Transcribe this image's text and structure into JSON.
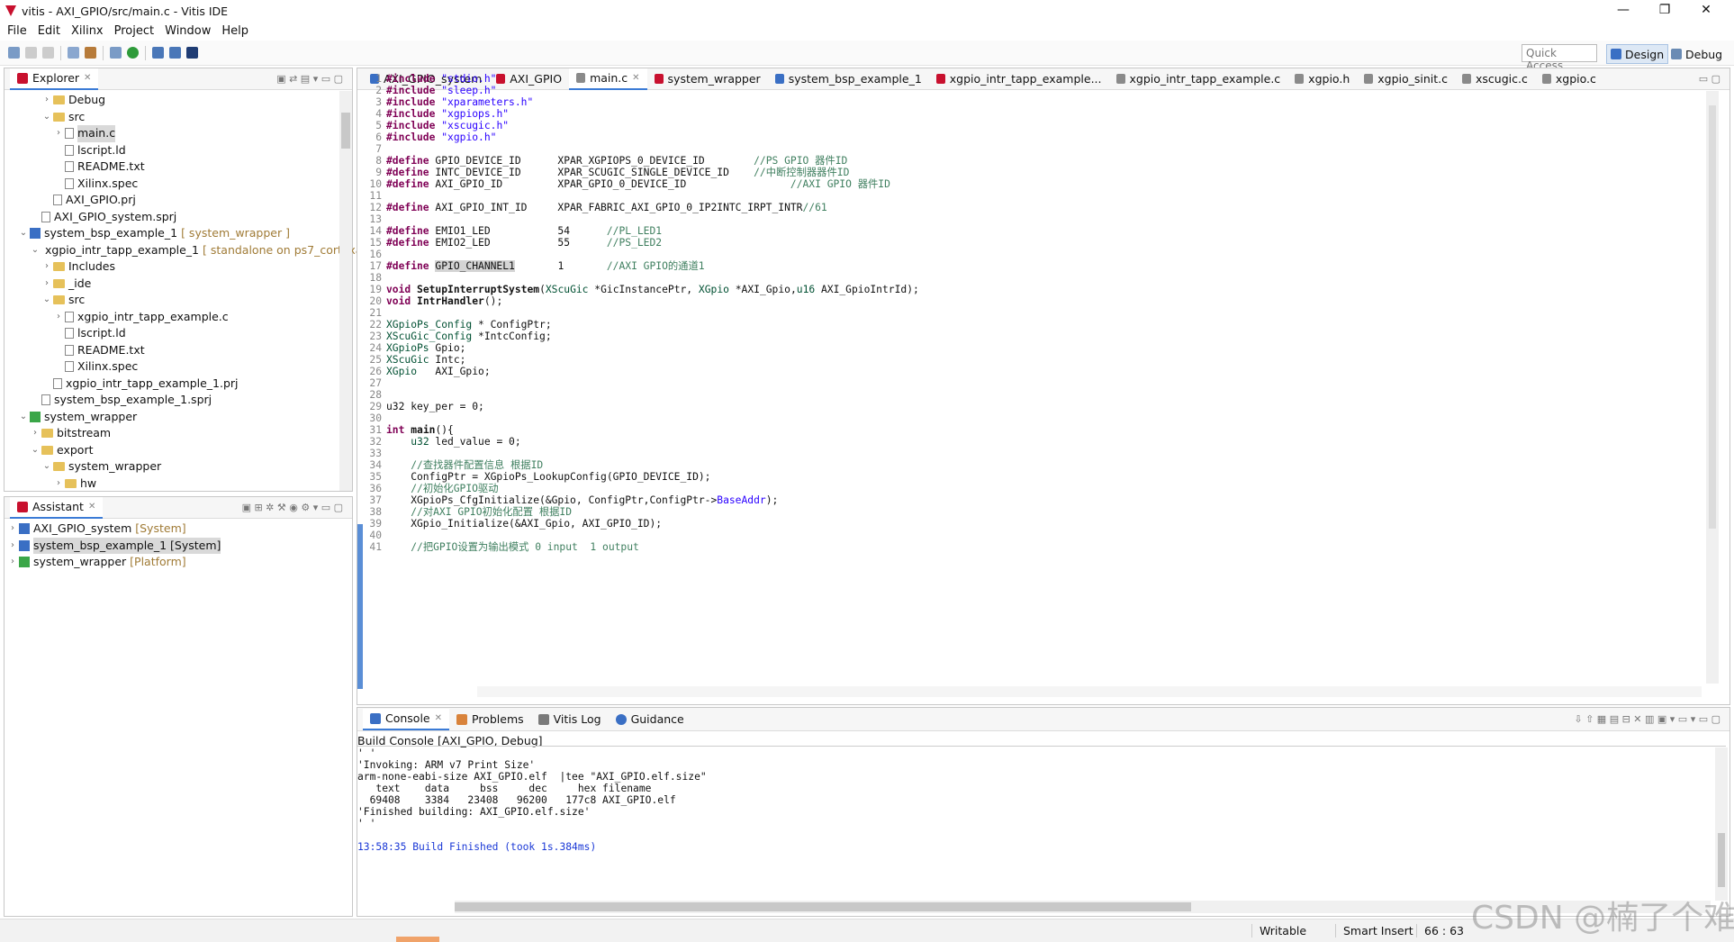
{
  "window": {
    "title": "vitis - AXI_GPIO/src/main.c - Vitis IDE"
  },
  "menu": [
    "File",
    "Edit",
    "Xilinx",
    "Project",
    "Window",
    "Help"
  ],
  "quick_access": "Quick Access",
  "perspectives": {
    "design": "Design",
    "debug": "Debug"
  },
  "explorer": {
    "tab": "Explorer",
    "rows": [
      {
        "indent": 2,
        "tw": "›",
        "icon": "folder",
        "label": "Debug",
        "dec": ""
      },
      {
        "indent": 2,
        "tw": "⌄",
        "icon": "folder",
        "label": "src",
        "dec": ""
      },
      {
        "indent": 3,
        "tw": "›",
        "icon": "file",
        "label": "main.c",
        "dec": "",
        "selected": true
      },
      {
        "indent": 3,
        "tw": "",
        "icon": "file",
        "label": "lscript.ld",
        "dec": ""
      },
      {
        "indent": 3,
        "tw": "",
        "icon": "file",
        "label": "README.txt",
        "dec": ""
      },
      {
        "indent": 3,
        "tw": "",
        "icon": "file",
        "label": "Xilinx.spec",
        "dec": ""
      },
      {
        "indent": 2,
        "tw": "",
        "icon": "file",
        "label": "AXI_GPIO.prj",
        "dec": ""
      },
      {
        "indent": 1,
        "tw": "",
        "icon": "file",
        "label": "AXI_GPIO_system.sprj",
        "dec": ""
      },
      {
        "indent": 0,
        "tw": "⌄",
        "icon": "proj",
        "label": "system_bsp_example_1",
        "dec": "[ system_wrapper ]"
      },
      {
        "indent": 1,
        "tw": "⌄",
        "icon": "proj",
        "label": "xgpio_intr_tapp_example_1",
        "dec": "[ standalone on ps7_cortexa9_0 ]"
      },
      {
        "indent": 2,
        "tw": "›",
        "icon": "folder",
        "label": "Includes",
        "dec": ""
      },
      {
        "indent": 2,
        "tw": "›",
        "icon": "folder",
        "label": "_ide",
        "dec": ""
      },
      {
        "indent": 2,
        "tw": "⌄",
        "icon": "folder",
        "label": "src",
        "dec": ""
      },
      {
        "indent": 3,
        "tw": "›",
        "icon": "file",
        "label": "xgpio_intr_tapp_example.c",
        "dec": ""
      },
      {
        "indent": 3,
        "tw": "",
        "icon": "file",
        "label": "lscript.ld",
        "dec": ""
      },
      {
        "indent": 3,
        "tw": "",
        "icon": "file",
        "label": "README.txt",
        "dec": ""
      },
      {
        "indent": 3,
        "tw": "",
        "icon": "file",
        "label": "Xilinx.spec",
        "dec": ""
      },
      {
        "indent": 2,
        "tw": "",
        "icon": "file",
        "label": "xgpio_intr_tapp_example_1.prj",
        "dec": ""
      },
      {
        "indent": 1,
        "tw": "",
        "icon": "file",
        "label": "system_bsp_example_1.sprj",
        "dec": ""
      },
      {
        "indent": 0,
        "tw": "⌄",
        "icon": "plat",
        "label": "system_wrapper",
        "dec": ""
      },
      {
        "indent": 1,
        "tw": "›",
        "icon": "folder",
        "label": "bitstream",
        "dec": ""
      },
      {
        "indent": 1,
        "tw": "⌄",
        "icon": "folder",
        "label": "export",
        "dec": ""
      },
      {
        "indent": 2,
        "tw": "⌄",
        "icon": "folder",
        "label": "system_wrapper",
        "dec": ""
      },
      {
        "indent": 3,
        "tw": "›",
        "icon": "folder",
        "label": "hw",
        "dec": ""
      }
    ]
  },
  "assistant": {
    "tab": "Assistant",
    "rows": [
      {
        "label": "AXI_GPIO_system",
        "dec": "[System]",
        "icon": "proj",
        "selected": false
      },
      {
        "label": "system_bsp_example_1 [System]",
        "dec": "",
        "icon": "proj",
        "selected": true
      },
      {
        "label": "system_wrapper",
        "dec": "[Platform]",
        "icon": "plat",
        "selected": false
      }
    ]
  },
  "editor_tabs": [
    {
      "label": "AXI_GPIO_system",
      "active": false
    },
    {
      "label": "AXI_GPIO",
      "active": false
    },
    {
      "label": "main.c",
      "active": true
    },
    {
      "label": "system_wrapper",
      "active": false
    },
    {
      "label": "system_bsp_example_1",
      "active": false
    },
    {
      "label": "xgpio_intr_tapp_example...",
      "active": false
    },
    {
      "label": "xgpio_intr_tapp_example.c",
      "active": false
    },
    {
      "label": "xgpio.h",
      "active": false
    },
    {
      "label": "xgpio_sinit.c",
      "active": false
    },
    {
      "label": "xscugic.c",
      "active": false
    },
    {
      "label": "xgpio.c",
      "active": false
    }
  ],
  "code_lines": [
    [
      [
        "kw",
        "#include"
      ],
      [
        "t",
        " "
      ],
      [
        "str",
        "\"stdio.h\""
      ]
    ],
    [
      [
        "kw",
        "#include"
      ],
      [
        "t",
        " "
      ],
      [
        "str",
        "\"sleep.h\""
      ]
    ],
    [
      [
        "kw",
        "#include"
      ],
      [
        "t",
        " "
      ],
      [
        "str",
        "\"xparameters.h\""
      ]
    ],
    [
      [
        "kw",
        "#include"
      ],
      [
        "t",
        " "
      ],
      [
        "str",
        "\"xgpiops.h\""
      ]
    ],
    [
      [
        "kw",
        "#include"
      ],
      [
        "t",
        " "
      ],
      [
        "str",
        "\"xscugic.h\""
      ]
    ],
    [
      [
        "kw",
        "#include"
      ],
      [
        "t",
        " "
      ],
      [
        "str",
        "\"xgpio.h\""
      ]
    ],
    [],
    [
      [
        "kw",
        "#define"
      ],
      [
        "t",
        " GPIO_DEVICE_ID      XPAR_XGPIOPS_0_DEVICE_ID        "
      ],
      [
        "cmt",
        "//PS GPIO 器件ID"
      ]
    ],
    [
      [
        "kw",
        "#define"
      ],
      [
        "t",
        " INTC_DEVICE_ID      XPAR_SCUGIC_SINGLE_DEVICE_ID    "
      ],
      [
        "cmt",
        "//中断控制器器件ID"
      ]
    ],
    [
      [
        "kw",
        "#define"
      ],
      [
        "t",
        " AXI_GPIO_ID         XPAR_GPIO_0_DEVICE_ID                 "
      ],
      [
        "cmt",
        "//AXI GPIO 器件ID"
      ]
    ],
    [],
    [
      [
        "kw",
        "#define"
      ],
      [
        "t",
        " AXI_GPIO_INT_ID     XPAR_FABRIC_AXI_GPIO_0_IP2INTC_IRPT_INTR"
      ],
      [
        "cmt",
        "//61"
      ]
    ],
    [],
    [
      [
        "kw",
        "#define"
      ],
      [
        "t",
        " EMIO1_LED           54      "
      ],
      [
        "cmt",
        "//PL_LED1"
      ]
    ],
    [
      [
        "kw",
        "#define"
      ],
      [
        "t",
        " EMIO2_LED           55      "
      ],
      [
        "cmt",
        "//PS_LED2"
      ]
    ],
    [],
    [
      [
        "kw",
        "#define"
      ],
      [
        "t",
        " GPIO_CHANNEL1       1       "
      ],
      [
        "cmt",
        "//AXI GPIO的通道1"
      ]
    ],
    [],
    [
      [
        "kw",
        "void"
      ],
      [
        "t",
        " "
      ],
      [
        "fn",
        "SetupInterruptSystem"
      ],
      [
        "t",
        "("
      ],
      [
        "ty",
        "XScuGic"
      ],
      [
        "t",
        " *GicInstancePtr, "
      ],
      [
        "ty",
        "XGpio"
      ],
      [
        "t",
        " *AXI_Gpio,"
      ],
      [
        "ty",
        "u16"
      ],
      [
        "t",
        " AXI_GpioIntrId);"
      ]
    ],
    [
      [
        "kw",
        "void"
      ],
      [
        "t",
        " "
      ],
      [
        "fn",
        "IntrHandler"
      ],
      [
        "t",
        "();"
      ]
    ],
    [],
    [
      [
        "ty",
        "XGpioPs_Config"
      ],
      [
        "t",
        " * ConfigPtr;"
      ]
    ],
    [
      [
        "ty",
        "XScuGic_Config"
      ],
      [
        "t",
        " *IntcConfig;"
      ]
    ],
    [
      [
        "ty",
        "XGpioPs"
      ],
      [
        "t",
        " Gpio;"
      ]
    ],
    [
      [
        "ty",
        "XScuGic"
      ],
      [
        "t",
        " Intc;"
      ]
    ],
    [
      [
        "ty",
        "XGpio"
      ],
      [
        "t",
        "   AXI_Gpio;"
      ]
    ],
    [],
    [],
    [
      [
        "t",
        "u32 key_per = 0;"
      ]
    ],
    [],
    [
      [
        "kw",
        "int"
      ],
      [
        "t",
        " "
      ],
      [
        "fn",
        "main"
      ],
      [
        "t",
        "(){"
      ]
    ],
    [
      [
        "t",
        "    "
      ],
      [
        "ty",
        "u32"
      ],
      [
        "t",
        " led_value = 0;"
      ]
    ],
    [],
    [
      [
        "t",
        "    "
      ],
      [
        "cmt",
        "//查找器件配置信息 根据ID"
      ]
    ],
    [
      [
        "t",
        "    ConfigPtr = XGpioPs_LookupConfig(GPIO_DEVICE_ID);"
      ]
    ],
    [
      [
        "t",
        "    "
      ],
      [
        "cmt",
        "//初始化GPIO驱动"
      ]
    ],
    [
      [
        "t",
        "    XGpioPs_CfgInitialize(&Gpio, ConfigPtr,ConfigPtr->"
      ],
      [
        "str",
        "BaseAddr"
      ],
      [
        "t",
        ");"
      ]
    ],
    [
      [
        "t",
        "    "
      ],
      [
        "cmt",
        "//对AXI GPIO初始化配置 根据ID"
      ]
    ],
    [
      [
        "t",
        "    XGpio_Initialize(&AXI_Gpio, AXI_GPIO_ID);"
      ]
    ],
    [],
    [
      [
        "t",
        "    "
      ],
      [
        "cmt",
        "//把GPIO设置为输出模式 0 input  1 output"
      ]
    ]
  ],
  "bottom_tabs": [
    "Console",
    "Problems",
    "Vitis Log",
    "Guidance"
  ],
  "console_title": "Build Console [AXI_GPIO, Debug]",
  "console_lines": [
    "' '",
    "'Invoking: ARM v7 Print Size'",
    "arm-none-eabi-size AXI_GPIO.elf  |tee \"AXI_GPIO.elf.size\"",
    "   text    data     bss     dec     hex filename",
    "  69408    3384   23408   96200   177c8 AXI_GPIO.elf",
    "'Finished building: AXI_GPIO.elf.size'",
    "' '",
    "",
    "13:58:35 Build Finished (took 1s.384ms)"
  ],
  "status": {
    "writable": "Writable",
    "insert": "Smart Insert",
    "position": "66 : 63"
  },
  "watermark": "CSDN @楠了个难",
  "colors": {
    "accent": "#3b7bd6",
    "keyword": "#7f0055",
    "string": "#2a00ff",
    "comment": "#3f7f5f",
    "build_finished": "#1a38d6"
  }
}
